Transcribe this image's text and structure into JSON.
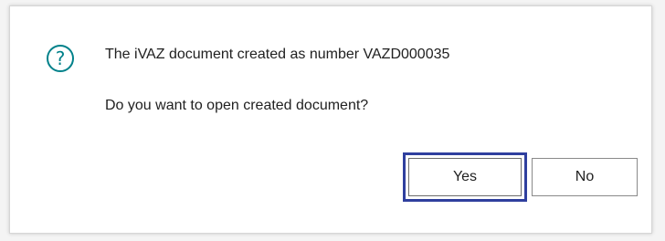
{
  "dialog": {
    "icon": "question-circle-icon",
    "message_line1": "The iVAZ document created as number VAZD000035",
    "message_line2": "Do you want to open created document?",
    "yes_label": "Yes",
    "no_label": "No",
    "focus_color": "#2f3f9e",
    "accent_color": "#00818a"
  }
}
